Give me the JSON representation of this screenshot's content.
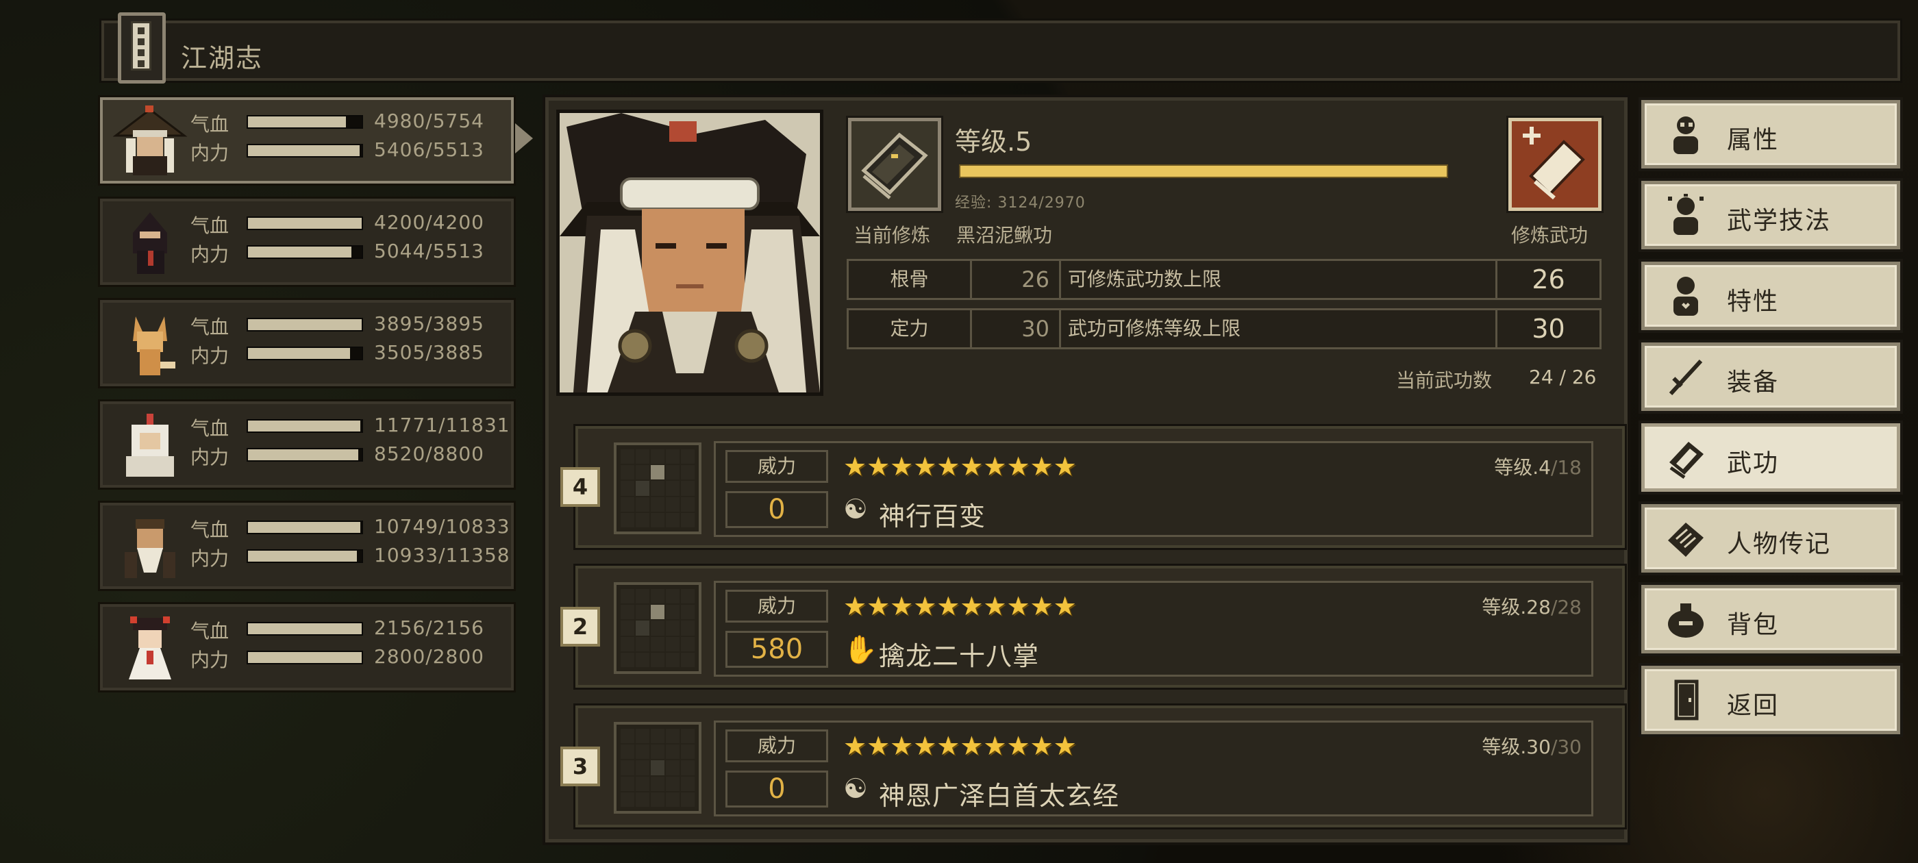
{
  "title": "江湖志",
  "characters": [
    {
      "hp_label": "气血",
      "mp_label": "内力",
      "hp": "4980/5754",
      "mp": "5406/5513",
      "hp_frac": 0.86,
      "mp_frac": 0.98
    },
    {
      "hp_label": "气血",
      "mp_label": "内力",
      "hp": "4200/4200",
      "mp": "5044/5513",
      "hp_frac": 1.0,
      "mp_frac": 0.91
    },
    {
      "hp_label": "气血",
      "mp_label": "内力",
      "hp": "3895/3895",
      "mp": "3505/3885",
      "hp_frac": 1.0,
      "mp_frac": 0.9
    },
    {
      "hp_label": "气血",
      "mp_label": "内力",
      "hp": "11771/11831",
      "mp": "8520/8800",
      "hp_frac": 0.99,
      "mp_frac": 0.97
    },
    {
      "hp_label": "气血",
      "mp_label": "内力",
      "hp": "10749/10833",
      "mp": "10933/11358",
      "hp_frac": 0.99,
      "mp_frac": 0.96
    },
    {
      "hp_label": "气血",
      "mp_label": "内力",
      "hp": "2156/2156",
      "mp": "2800/2800",
      "hp_frac": 1.0,
      "mp_frac": 1.0
    }
  ],
  "detail": {
    "level": "等级.5",
    "xp": "经验: 3124/2970",
    "xp_frac": 1.0,
    "current_label": "当前修炼",
    "current_skill": "黑沼泥鳅功",
    "practice_label": "修炼武功",
    "stats": [
      {
        "key": "根骨",
        "value": "26",
        "desc": "可修炼武功数上限",
        "result": "26"
      },
      {
        "key": "定力",
        "value": "30",
        "desc": "武功可修炼等级上限",
        "result": "30"
      }
    ],
    "skill_count_label": "当前武功数",
    "skill_count": "24 / 26"
  },
  "skills": [
    {
      "badge": "4",
      "power_label": "威力",
      "power": "0",
      "stars": "★★★★★★★★★★",
      "level": "等级.4",
      "level_max": "/18",
      "icon": "☯",
      "name": "神行百变"
    },
    {
      "badge": "2",
      "power_label": "威力",
      "power": "580",
      "stars": "★★★★★★★★★★",
      "level": "等级.28",
      "level_max": "/28",
      "icon": "✋",
      "name": "擒龙二十八掌"
    },
    {
      "badge": "3",
      "power_label": "威力",
      "power": "0",
      "stars": "★★★★★★★★★★",
      "level": "等级.30",
      "level_max": "/30",
      "icon": "☯",
      "name": "神恩广泽白首太玄经"
    }
  ],
  "menu": [
    {
      "label": "属性",
      "icon": "person-icon"
    },
    {
      "label": "武学技法",
      "icon": "martial-icon"
    },
    {
      "label": "特性",
      "icon": "trait-icon"
    },
    {
      "label": "装备",
      "icon": "sword-icon"
    },
    {
      "label": "武功",
      "icon": "book-icon"
    },
    {
      "label": "人物传记",
      "icon": "scroll-icon"
    },
    {
      "label": "背包",
      "icon": "bag-icon"
    },
    {
      "label": "返回",
      "icon": "door-icon"
    }
  ],
  "colors": {
    "accent": "#e9c55d",
    "power": "#e2b246",
    "star": "#f2c33d",
    "menu_bg": "#d8d0b6",
    "practice_bg": "#8e3e22"
  }
}
